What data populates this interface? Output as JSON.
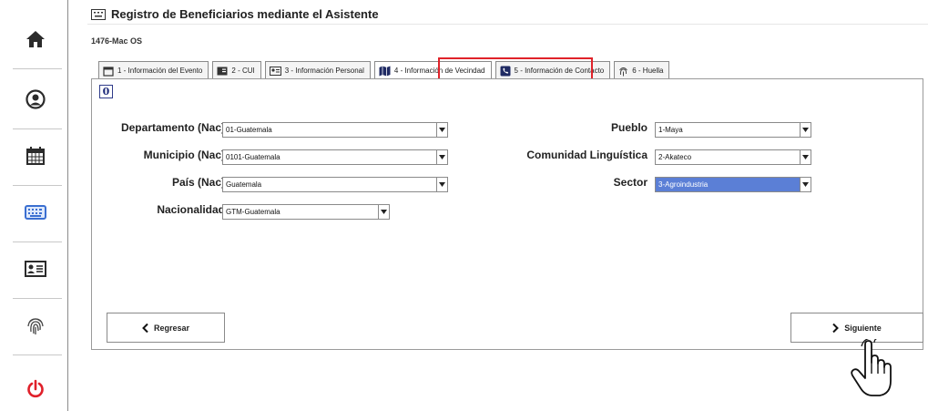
{
  "sidebar": {
    "items": [
      {
        "id": "home",
        "icon": "home-icon"
      },
      {
        "id": "profile",
        "icon": "user-circle-icon"
      },
      {
        "id": "calendar",
        "icon": "calendar-icon"
      },
      {
        "id": "keyboard",
        "icon": "keyboard-icon",
        "active": true
      },
      {
        "id": "id-card",
        "icon": "id-card-icon"
      },
      {
        "id": "fingerprint",
        "icon": "fingerprint-icon"
      },
      {
        "id": "power",
        "icon": "power-icon",
        "color": "#e0202a"
      }
    ]
  },
  "header": {
    "title": "Registro de Beneficiarios mediante el Asistente",
    "subtitle": "1476-Mac OS"
  },
  "tabs": [
    {
      "label": "1 - Información del Evento",
      "icon": "calendar-icon"
    },
    {
      "label": "2 - CUI",
      "icon": "card-icon"
    },
    {
      "label": "3 - Información Personal",
      "icon": "id-card-icon"
    },
    {
      "label": "4 - Información de Vecindad",
      "icon": "map-icon",
      "active": true
    },
    {
      "label": "5 - Información de Contacto",
      "icon": "phone-icon"
    },
    {
      "label": "6 - Huella",
      "icon": "fingerprint-icon"
    }
  ],
  "info_button": {
    "label": "0",
    "icon": "info-icon"
  },
  "form": {
    "left": [
      {
        "label": "Departamento (Nac)",
        "value": "01-Guatemala"
      },
      {
        "label": "Municipio (Nac)",
        "value": "0101-Guatemala"
      },
      {
        "label": "País (Nac)",
        "value": "Guatemala"
      },
      {
        "label": "Nacionalidad",
        "value": "GTM-Guatemala"
      }
    ],
    "right": [
      {
        "label": "Pueblo",
        "value": "1-Maya"
      },
      {
        "label": "Comunidad Linguística",
        "value": "2-Akateco"
      },
      {
        "label": "Sector",
        "value": "3-Agroindustria",
        "highlighted": true
      }
    ]
  },
  "buttons": {
    "back_label": "Regresar",
    "next_label": "Siguiente"
  },
  "colors": {
    "active_tab_outline": "#e0232a",
    "power": "#e0202a",
    "keyboard_icon": "#3b6fd1",
    "selected_option": "#5b7fd6"
  }
}
